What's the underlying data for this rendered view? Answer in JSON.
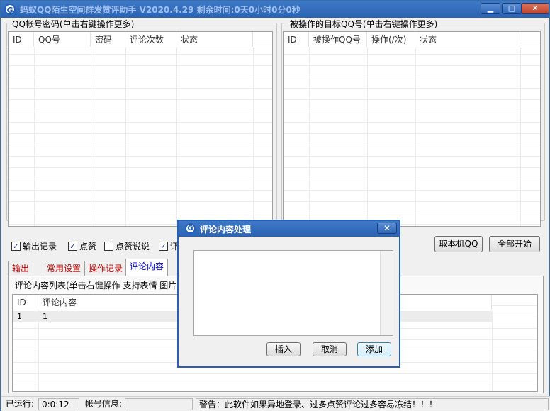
{
  "window": {
    "title": "蚂蚁QQ陌生空间群发赞评助手 V2020.4.29 剩余时间:0天0小时0分0秒",
    "minimize_glyph": "▁",
    "maximize_glyph": "□",
    "close_glyph": "✕",
    "app_icon_letter": "G"
  },
  "accounts_group": {
    "label": "QQ帐号密码(单击右键操作更多)",
    "columns": [
      "ID",
      "QQ号",
      "密码",
      "评论次数",
      "状态"
    ]
  },
  "targets_group": {
    "label": "被操作的目标QQ号(单击右键操作更多)",
    "columns": [
      "ID",
      "被操作QQ号",
      "操作(/次)",
      "状态"
    ]
  },
  "options": {
    "output_log": {
      "label": "输出记录",
      "checked": true
    },
    "like": {
      "label": "点赞",
      "checked": true
    },
    "like_posts": {
      "label": "点赞说说",
      "checked": false
    },
    "comment": {
      "label": "评",
      "checked": true
    }
  },
  "buttons": {
    "get_local_qq": "取本机QQ",
    "start_all": "全部开始"
  },
  "tabs": [
    {
      "label": "输出"
    },
    {
      "label": "常用设置"
    },
    {
      "label": "操作记录"
    },
    {
      "label": "评论内容"
    }
  ],
  "comment_panel": {
    "label": "评论内容列表(单击右键操作  支持表情  图片",
    "columns": [
      "ID",
      "评论内容"
    ],
    "rows": [
      {
        "id": "1",
        "content": "1"
      }
    ]
  },
  "status": {
    "running_label": "已运行:",
    "running_value": "0:0:12",
    "account_label": "帐号信息:",
    "warning": "警告：此软件如果异地登录、过多点赞评论过多容易冻结！！！"
  },
  "dialog": {
    "title": "评论内容处理",
    "close_glyph": "✕",
    "text_value": "",
    "buttons": {
      "insert": "插入",
      "cancel": "取消",
      "add": "添加"
    }
  },
  "colors": {
    "titlebar": "#2a63b2",
    "tab_inactive_text": "#c00000",
    "tab_active_text": "#0000cc"
  }
}
